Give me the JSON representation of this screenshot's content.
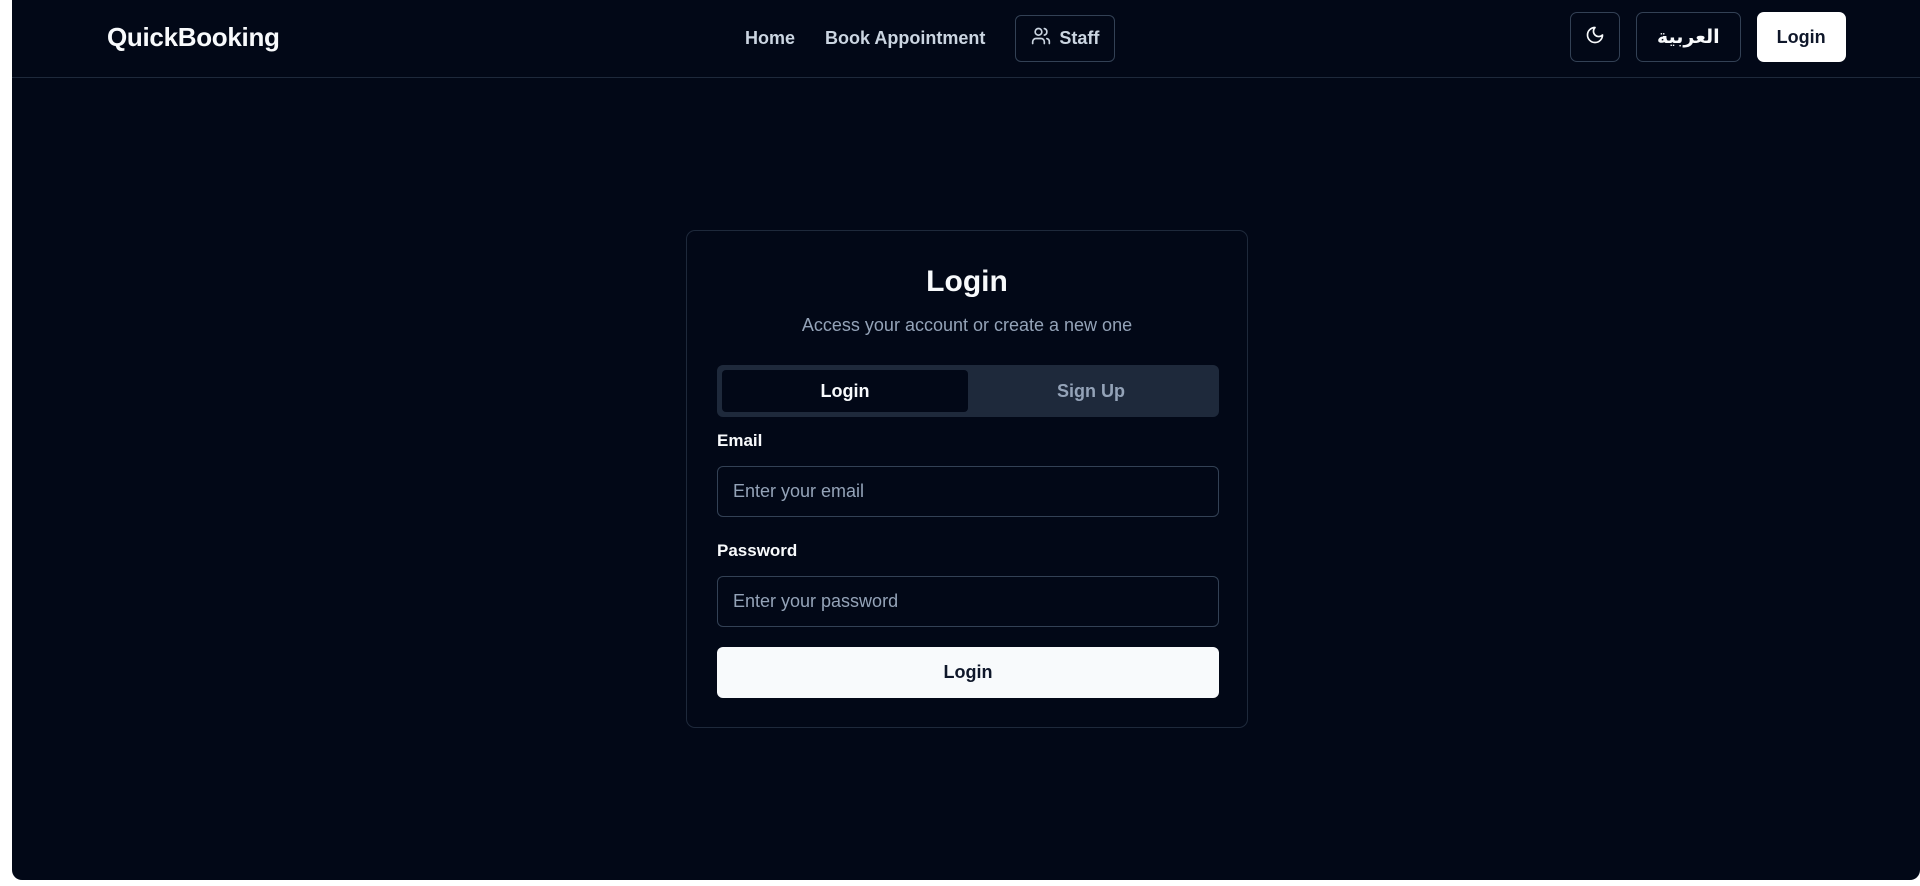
{
  "header": {
    "brand": "QuickBooking",
    "nav": {
      "home": "Home",
      "book": "Book Appointment",
      "staff": "Staff",
      "staff_icon": "users-icon"
    },
    "theme_icon": "moon-icon",
    "language": "العربية",
    "login": "Login"
  },
  "card": {
    "title": "Login",
    "subtitle": "Access your account or create a new one",
    "tabs": [
      {
        "label": "Login",
        "active": true
      },
      {
        "label": "Sign Up",
        "active": false
      }
    ],
    "email": {
      "label": "Email",
      "placeholder": "Enter your email",
      "value": ""
    },
    "password": {
      "label": "Password",
      "placeholder": "Enter your password",
      "value": ""
    },
    "submit": "Login"
  },
  "colors": {
    "background": "#020817",
    "border": "#1e293b",
    "muted_text": "#94a3b8",
    "primary_button": "#f8fafc"
  }
}
